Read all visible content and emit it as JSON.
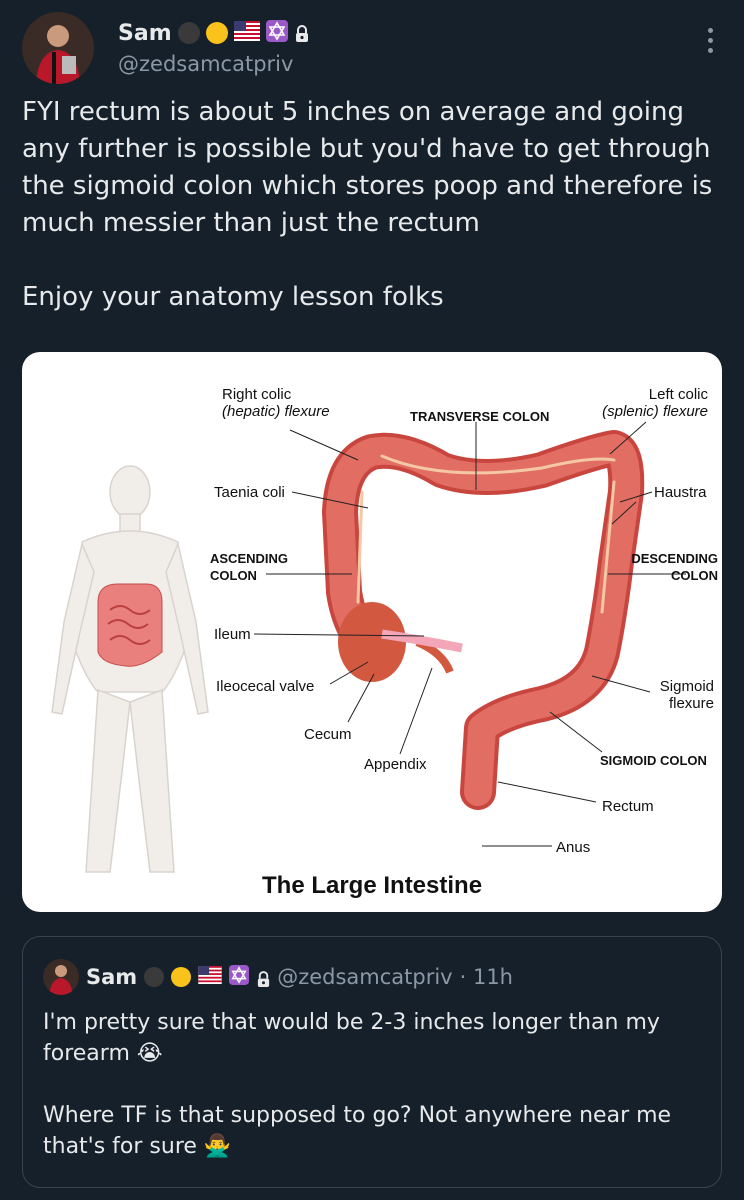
{
  "post": {
    "author_name": "Sam",
    "author_handle": "@zedsamcatpriv",
    "paragraphs": [
      "FYI rectum is about 5 inches on average and going any further is possible but you'd have to get through the sigmoid colon which stores poop and therefore is much messier than just the rectum",
      "Enjoy your anatomy lesson folks"
    ],
    "badges": [
      "black-circle-emoji",
      "yellow-circle-emoji",
      "us-flag-emoji",
      "star-of-david-emoji",
      "lock-icon"
    ]
  },
  "image": {
    "caption": "The Large Intestine",
    "labels": {
      "right_colic_1": "Right colic",
      "right_colic_2": "(hepatic) flexure",
      "transverse": "TRANSVERSE COLON",
      "left_colic_1": "Left colic",
      "left_colic_2": "(splenic) flexure",
      "taenia": "Taenia coli",
      "haustra": "Haustra",
      "ascending_1": "ASCENDING",
      "ascending_2": "COLON",
      "descending_1": "DESCENDING",
      "descending_2": "COLON",
      "ileum": "Ileum",
      "ileocecal": "Ileocecal valve",
      "sigmoid_flexure_1": "Sigmoid",
      "sigmoid_flexure_2": "flexure",
      "cecum": "Cecum",
      "appendix": "Appendix",
      "sigmoid_colon": "SIGMOID COLON",
      "rectum": "Rectum",
      "anus": "Anus"
    }
  },
  "quote": {
    "author_name": "Sam",
    "author_handle": "@zedsamcatpriv",
    "time": "· 11h",
    "line1": "I'm pretty sure that would be 2-3 inches longer than my forearm 😭",
    "line2": "Where TF is that supposed to go?  Not anywhere near me that's for sure 🙅‍♂️"
  },
  "colors": {
    "background": "#15202b",
    "text": "#e7e9ea",
    "secondary": "#8b98a5",
    "colon": "#e0625c"
  }
}
